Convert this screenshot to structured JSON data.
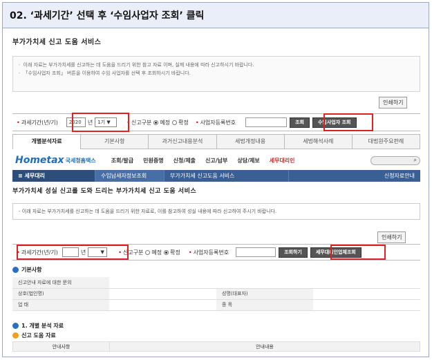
{
  "step_title": "02. ‘과세기간’ 선택 후 ‘수임사업자 조회’ 클릭",
  "upper": {
    "heading": "부가가치세 신고 도움 서비스",
    "notes": [
      "이래 자료는 부가가치세를 신고하는 데 도움을 드리기 위한 참고 자료 이며, 실제 내용에 따라 신고하시기 바랍니다.",
      "「수임사업자 조회」 버튼을 이용하여 수임 사업자를 선택 후 조회하시기 바랍니다."
    ],
    "print_label": "인쇄하기",
    "form": {
      "period_label": "과세기간(년/기)",
      "year_value": "2020",
      "year_suffix": "년",
      "term_value": "1기",
      "type_label": "신고구분",
      "type_opt1": "예정",
      "type_opt2": "확정",
      "bizno_label": "사업자등록번호",
      "search_label": "조회",
      "client_search_label": "수임사업자 조회"
    },
    "tabs": [
      "개별분석자료",
      "기본사항",
      "과거신고내용분석",
      "세법개정내용",
      "세법해석사례",
      "대법원주요판례"
    ]
  },
  "hometax": {
    "logo": "Hometax",
    "logo_sub": "국세청홈택스",
    "menu": [
      "조회/발급",
      "민원증명",
      "신청/제출",
      "신고/납부",
      "상담/제보",
      "세무대리인"
    ],
    "nav": [
      "세무대리",
      "수임납세자정보조회",
      "부가가치세 신고도움 서비스",
      "신청자료안내"
    ]
  },
  "lower": {
    "heading": "부가가치세 성실 신고를 도와 드리는 부가가치세 신고 도움 서비스",
    "note": "이래 자료는 부가가치세를 신고하는 데 도움을 드리기 위한 자료로, 이를 참고하여 성실 내용에 따라 신고하여 주시기 바랍니다.",
    "print_label": "인쇄하기",
    "form": {
      "period_label": "과세기간(년/기)",
      "year_suffix": "년",
      "type_label": "신고구분",
      "type_opt1": "예정",
      "type_opt2": "확정",
      "bizno_label": "사업자등록번호",
      "search_label": "조회하기",
      "client_search_label": "세무대리인업체조회"
    },
    "basic_heading": "기본사항",
    "basic_rows": [
      {
        "k1": "신고안내 자료에 대한 문의",
        "v1": "",
        "k2": "",
        "v2": ""
      },
      {
        "k1": "상호(법인명)",
        "v1": "",
        "k2": "성명(대표자)",
        "v2": ""
      },
      {
        "k1": "업 태",
        "v1": "",
        "k2": "종 목",
        "v2": ""
      }
    ],
    "analysis_heading": "1. 개별 분석 자료",
    "help_heading": "신고 도움 자료",
    "help_cols": [
      "안내사항",
      "안내내용"
    ]
  }
}
